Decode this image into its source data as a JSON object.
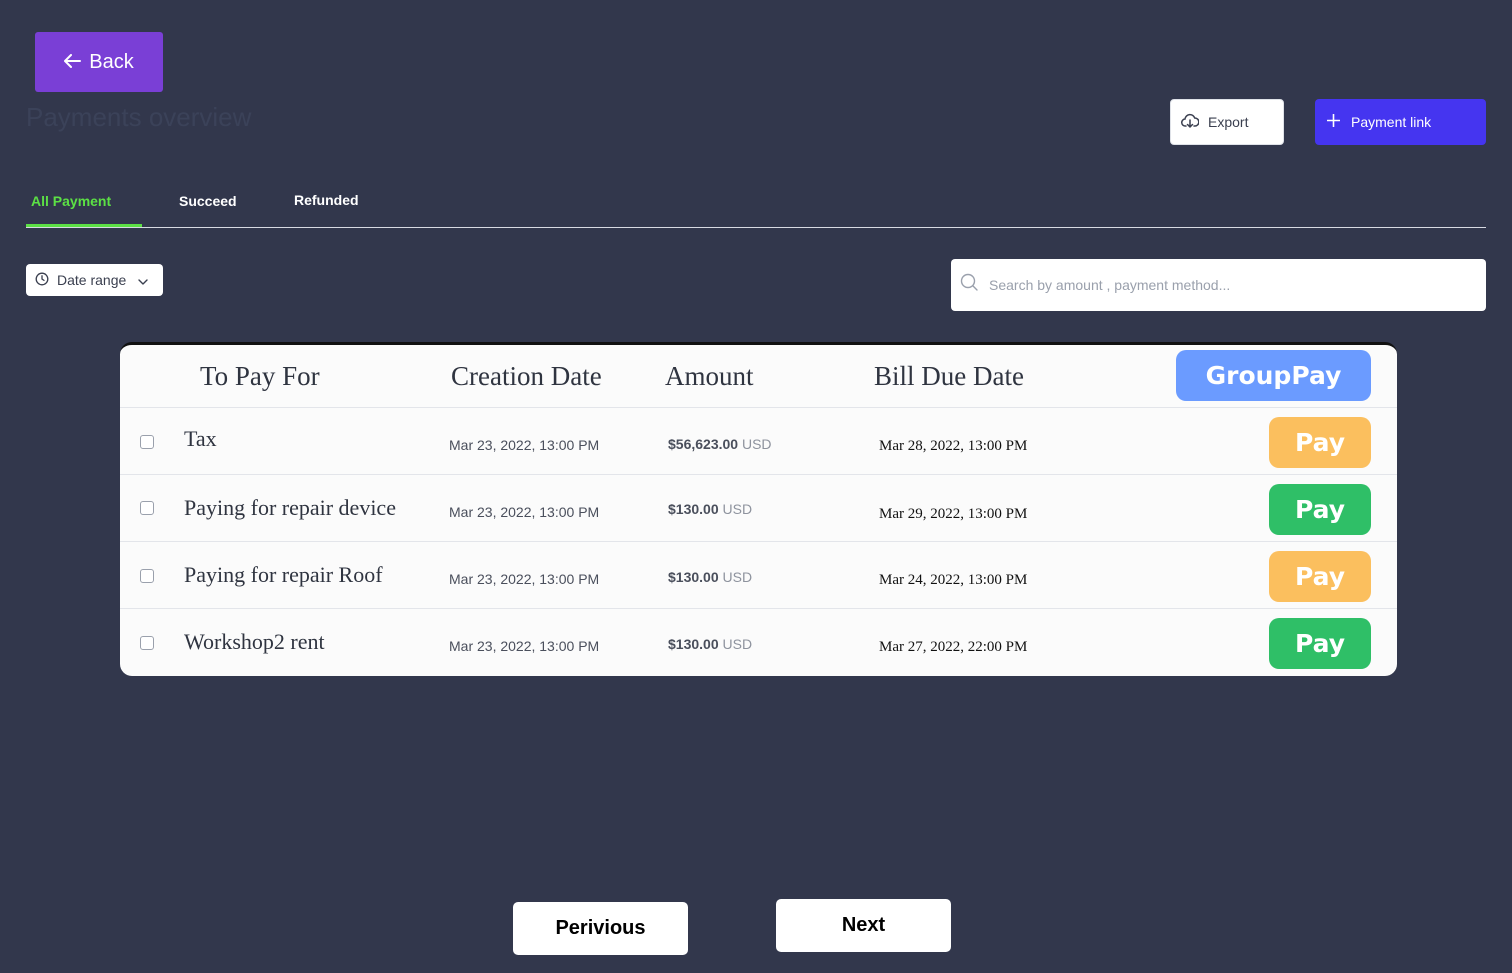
{
  "header": {
    "back_label": "Back",
    "title": "Payments overview",
    "export_label": "Export",
    "payment_link_label": "Payment link"
  },
  "tabs": [
    {
      "label": "All Payment",
      "active": true
    },
    {
      "label": "Succeed",
      "active": false
    },
    {
      "label": "Refunded",
      "active": false
    }
  ],
  "filters": {
    "date_range_label": "Date range",
    "search_placeholder": "Search by amount , payment method..."
  },
  "table": {
    "columns": [
      "To Pay For",
      "Creation Date",
      "Amount",
      "Bill Due Date"
    ],
    "group_pay_label": "GroupPay",
    "rows": [
      {
        "name": "Tax",
        "created": "Mar 23, 2022, 13:00 PM",
        "amount": "$56,623.00",
        "currency": "USD",
        "due": "Mar 28, 2022, 13:00 PM",
        "pay_label": "Pay",
        "pay_color": "#fbbf5e"
      },
      {
        "name": "Paying for repair device",
        "created": "Mar 23, 2022, 13:00 PM",
        "amount": "$130.00",
        "currency": "USD",
        "due": "Mar 29, 2022, 13:00 PM",
        "pay_label": "Pay",
        "pay_color": "#2fbf67"
      },
      {
        "name": "Paying for repair Roof",
        "created": "Mar 23, 2022, 13:00 PM",
        "amount": "$130.00",
        "currency": "USD",
        "due": "Mar 24, 2022, 13:00 PM",
        "pay_label": "Pay",
        "pay_color": "#fbbf5e"
      },
      {
        "name": "Workshop2 rent",
        "created": "Mar 23, 2022, 13:00 PM",
        "amount": "$130.00",
        "currency": "USD",
        "due": "Mar 27, 2022, 22:00 PM",
        "pay_label": "Pay",
        "pay_color": "#2fbf67"
      }
    ]
  },
  "pagination": {
    "previous_label": "Perivious",
    "next_label": "Next"
  },
  "colors": {
    "background": "#32374c",
    "back_button": "#7a3fd6",
    "payment_link_button": "#4535f0",
    "active_tab": "#5ce045",
    "group_pay_button": "#6b9bff"
  }
}
